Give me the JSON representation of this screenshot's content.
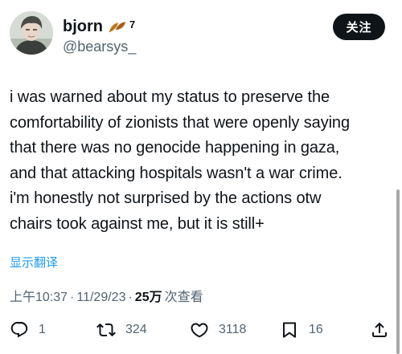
{
  "author": {
    "display_name": "bjorn",
    "name_suffix": "7",
    "handle": "@bearsys_",
    "name_emoji": "leaf-emoji"
  },
  "follow_button": {
    "label": "关注"
  },
  "tweet": {
    "lines": [
      "i was warned about my status to preserve the",
      "comfortability of zionists that were openly saying",
      "that there was no genocide happening in gaza,",
      "and that attacking hospitals wasn't a war crime.",
      "i'm honestly not surprised by the actions otw",
      "chairs took against me, but it is still+"
    ]
  },
  "translate": {
    "label": "显示翻译"
  },
  "meta": {
    "time": "上午10:37",
    "separator": "·",
    "date": "11/29/23",
    "views_count": "25万",
    "views_label": "次查看"
  },
  "actions": {
    "replies": "1",
    "reposts": "324",
    "likes": "3118",
    "bookmarks": "16"
  },
  "colors": {
    "text": "#0f1419",
    "secondary": "#536471",
    "link": "#1d9bf0",
    "button_bg": "#0f1419"
  }
}
